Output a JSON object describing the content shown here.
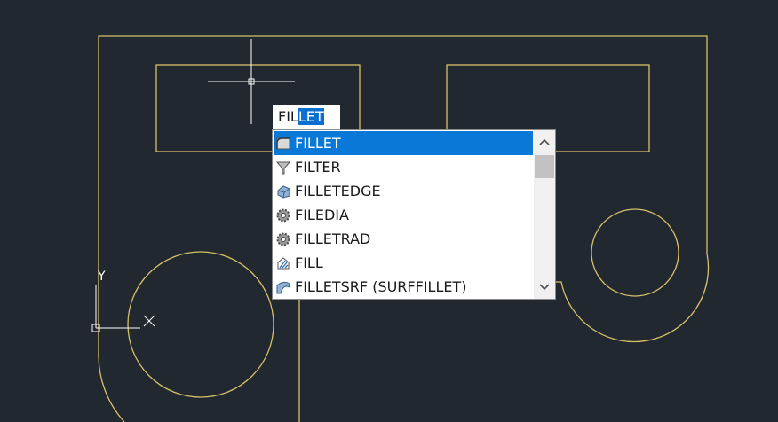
{
  "command_line": {
    "typed": "FIL",
    "autocomplete": "LET"
  },
  "autocomplete": {
    "items": [
      {
        "label": "FILLET",
        "icon": "fillet-icon",
        "selected": true
      },
      {
        "label": "FILTER",
        "icon": "filter-funnel-icon",
        "selected": false
      },
      {
        "label": "FILLETEDGE",
        "icon": "filletedge-icon",
        "selected": false
      },
      {
        "label": "FILEDIA",
        "icon": "system-variable-gear-icon",
        "selected": false
      },
      {
        "label": "FILLETRAD",
        "icon": "system-variable-gear-icon",
        "selected": false
      },
      {
        "label": "FILL",
        "icon": "fill-icon",
        "selected": false
      },
      {
        "label": "FILLETSRF (SURFFILLET)",
        "icon": "surffillet-icon",
        "selected": false
      }
    ]
  },
  "ucs": {
    "x_label": "X",
    "y_label": "Y"
  },
  "colors": {
    "background": "#212830",
    "geometry": "#d7c06a",
    "crosshair": "#ffffff",
    "selection": "#0a78d7"
  }
}
